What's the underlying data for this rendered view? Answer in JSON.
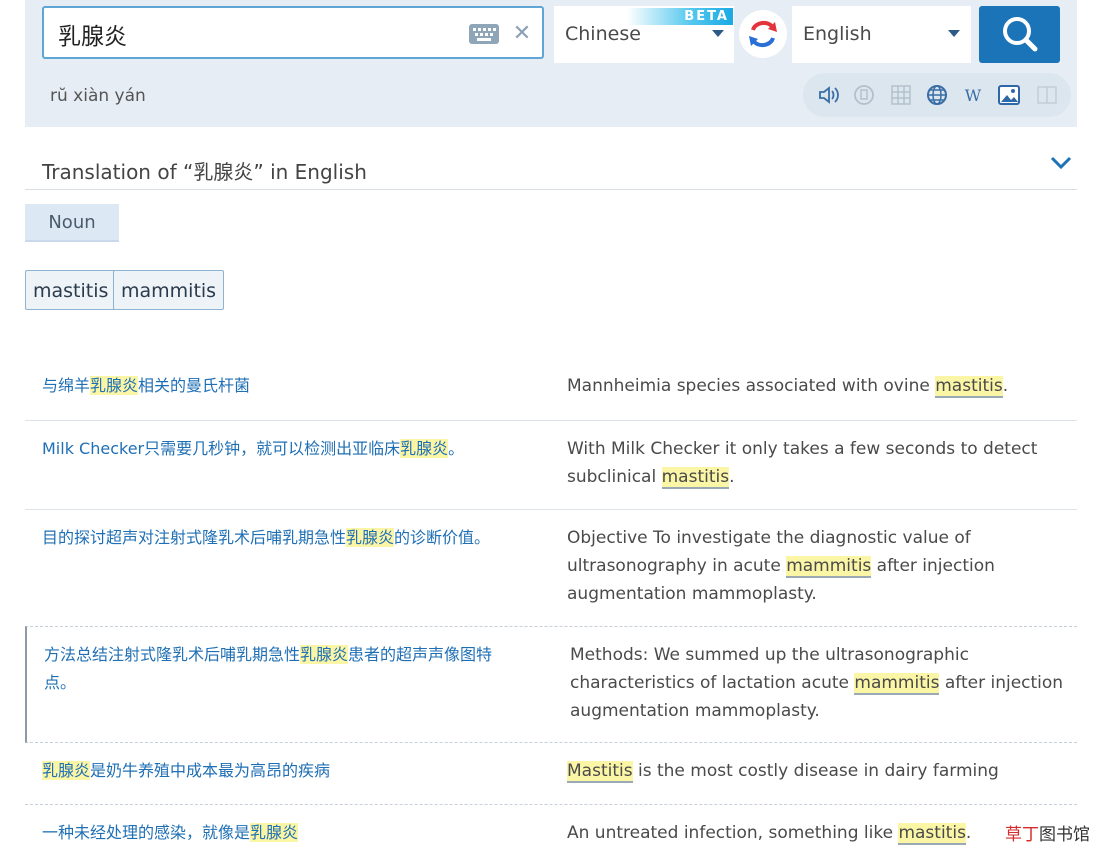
{
  "search": {
    "value": "乳腺炎",
    "pinyin": "rŭ xiàn yán"
  },
  "languages": {
    "source": "Chinese",
    "beta_badge": "BETA",
    "target": "English"
  },
  "header": {
    "prefix": "Translation of ",
    "open_quote": "“",
    "term": "乳腺炎",
    "close_quote": "”",
    "suffix": " in English"
  },
  "part_of_speech": "Noun",
  "translations": [
    "mastitis",
    "mammitis"
  ],
  "examples": [
    {
      "zh": [
        [
          "与绵羊",
          ""
        ],
        [
          "乳腺炎",
          "hl"
        ],
        [
          "相关的曼氏杆菌",
          ""
        ]
      ],
      "en": [
        [
          "Mannheimia species associated with ovine ",
          ""
        ],
        [
          "mastitis",
          "hl"
        ],
        [
          ".",
          ""
        ]
      ]
    },
    {
      "zh": [
        [
          "Milk Checker只需要几秒钟，就可以检测出亚临床",
          ""
        ],
        [
          "乳腺炎",
          "hl"
        ],
        [
          "。",
          ""
        ]
      ],
      "en": [
        [
          "With Milk Checker it only takes a few seconds to detect subclinical ",
          ""
        ],
        [
          "mastitis",
          "hl"
        ],
        [
          ".",
          ""
        ]
      ]
    },
    {
      "zh": [
        [
          "目的探讨超声对注射式隆乳术后哺乳期急性",
          ""
        ],
        [
          "乳腺炎",
          "hl"
        ],
        [
          "的诊断价值。",
          ""
        ]
      ],
      "en": [
        [
          "Objective To investigate the diagnostic value of ultrasonography in acute ",
          ""
        ],
        [
          "mammitis",
          "hl"
        ],
        [
          " after injection augmentation mammoplasty.",
          ""
        ]
      ]
    },
    {
      "zh": [
        [
          "方法总结注射式隆乳术后哺乳期急性",
          ""
        ],
        [
          "乳腺炎",
          "hl"
        ],
        [
          "患者的超声声像图特点。",
          ""
        ]
      ],
      "en": [
        [
          "Methods: We summed up the ultrasonographic characteristics of lactation acute ",
          ""
        ],
        [
          "mammitis",
          "hl"
        ],
        [
          " after injection augmentation mammoplasty.",
          ""
        ]
      ]
    },
    {
      "zh": [
        [
          "乳腺炎",
          "hl"
        ],
        [
          "是奶牛养殖中成本最为高昂的疾病",
          ""
        ]
      ],
      "en": [
        [
          "Mastitis",
          "hl"
        ],
        [
          " is the most costly disease in dairy farming",
          ""
        ]
      ]
    },
    {
      "zh": [
        [
          "一种未经处理的感染，就像是",
          ""
        ],
        [
          "乳腺炎",
          "hl"
        ]
      ],
      "en": [
        [
          "An untreated infection, something like ",
          ""
        ],
        [
          "mastitis",
          "hl"
        ],
        [
          ".",
          ""
        ]
      ]
    }
  ],
  "watermark": {
    "red": "草丁",
    "black": "图书馆"
  },
  "icons": [
    "keyboard-icon",
    "clear-icon",
    "swap-icon",
    "search-icon",
    "speaker-icon",
    "copy-icon",
    "grid-icon",
    "globe-icon",
    "wikipedia-icon",
    "image-icon",
    "book-icon",
    "chevron-down-icon"
  ],
  "colors": {
    "accent": "#1b73b8",
    "highlight": "#fbf5a6",
    "link": "#1f6fb5",
    "panel": "#e6edf4"
  }
}
